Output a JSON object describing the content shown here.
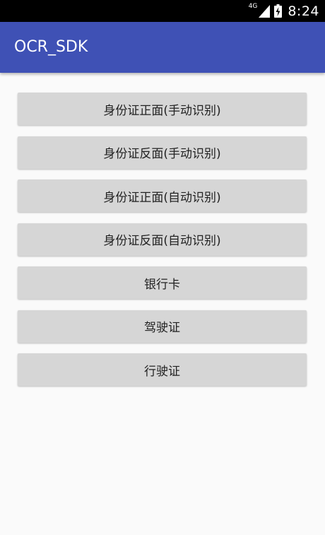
{
  "status_bar": {
    "network_type": "4G",
    "signal_icon": "cellular-signal-icon",
    "battery_icon": "battery-charging-icon",
    "time": "8:24"
  },
  "app_bar": {
    "title": "OCR_SDK",
    "color": "#3f51b5"
  },
  "buttons": [
    {
      "label": "身份证正面(手动识别)"
    },
    {
      "label": "身份证反面(手动识别)"
    },
    {
      "label": "身份证正面(自动识别)"
    },
    {
      "label": "身份证反面(自动识别)"
    },
    {
      "label": "银行卡"
    },
    {
      "label": "驾驶证"
    },
    {
      "label": "行驶证"
    }
  ]
}
